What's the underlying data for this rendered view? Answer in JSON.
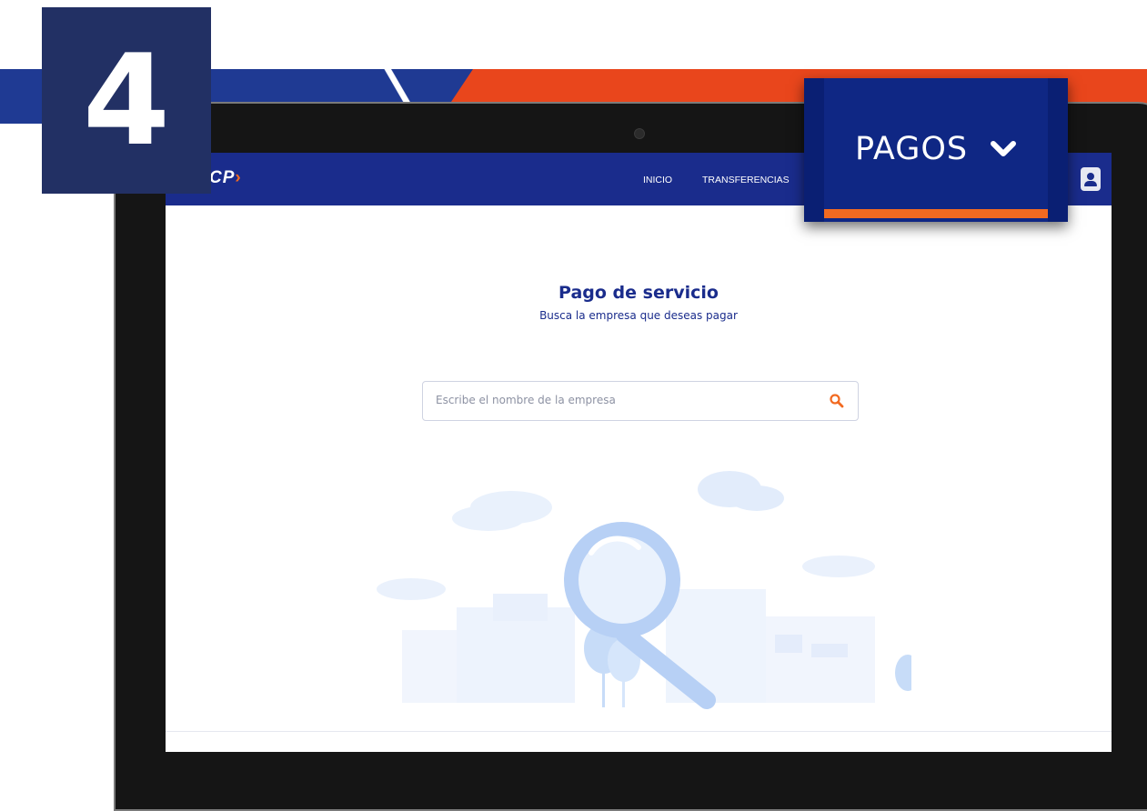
{
  "step": {
    "number": "4"
  },
  "app": {
    "logo": "CP",
    "nav": {
      "inicio": "INICIO",
      "transferencias": "TRANSFERENCIAS",
      "pagos": "PAGOS"
    },
    "icons": {
      "user": "user-icon",
      "search": "search-icon",
      "chevron": "chevron-down-icon"
    }
  },
  "page": {
    "title": "Pago de servicio",
    "subtitle": "Busca la empresa que deseas pagar",
    "search": {
      "placeholder": "Escribe el nombre de la empresa",
      "value": ""
    }
  },
  "colors": {
    "primary": "#1a2c8c",
    "accent": "#f26a21",
    "badge": "#223064"
  }
}
